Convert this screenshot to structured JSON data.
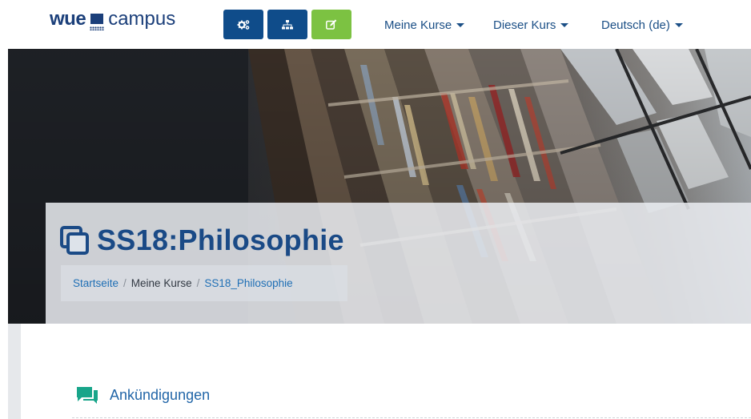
{
  "navbar": {
    "logo": {
      "part1": "wue",
      "part2": "campus"
    },
    "icon_buttons": [
      {
        "icon": "gears-icon",
        "color": "#0f4c8a"
      },
      {
        "icon": "sitemap-icon",
        "color": "#0f4c8a"
      },
      {
        "icon": "edit-icon",
        "color": "#7cc242"
      }
    ],
    "menus": [
      {
        "label": "Meine Kurse"
      },
      {
        "label": "Dieser Kurs"
      },
      {
        "label": "Deutsch (de)"
      }
    ]
  },
  "hero": {
    "course_title": "SS18:Philosophie",
    "breadcrumb": [
      "Startseite",
      "Meine Kurse",
      "SS18_Philosophie"
    ],
    "breadcrumb_separator": "/"
  },
  "content": {
    "sections": [
      {
        "label": "Ankündigungen",
        "icon": "forum-icon",
        "icon_color": "#18a58a"
      }
    ]
  },
  "colors": {
    "brand_blue": "#1b3f7a",
    "button_blue": "#0f4c8a",
    "button_green": "#7cc242",
    "link": "#1f6fb5"
  }
}
